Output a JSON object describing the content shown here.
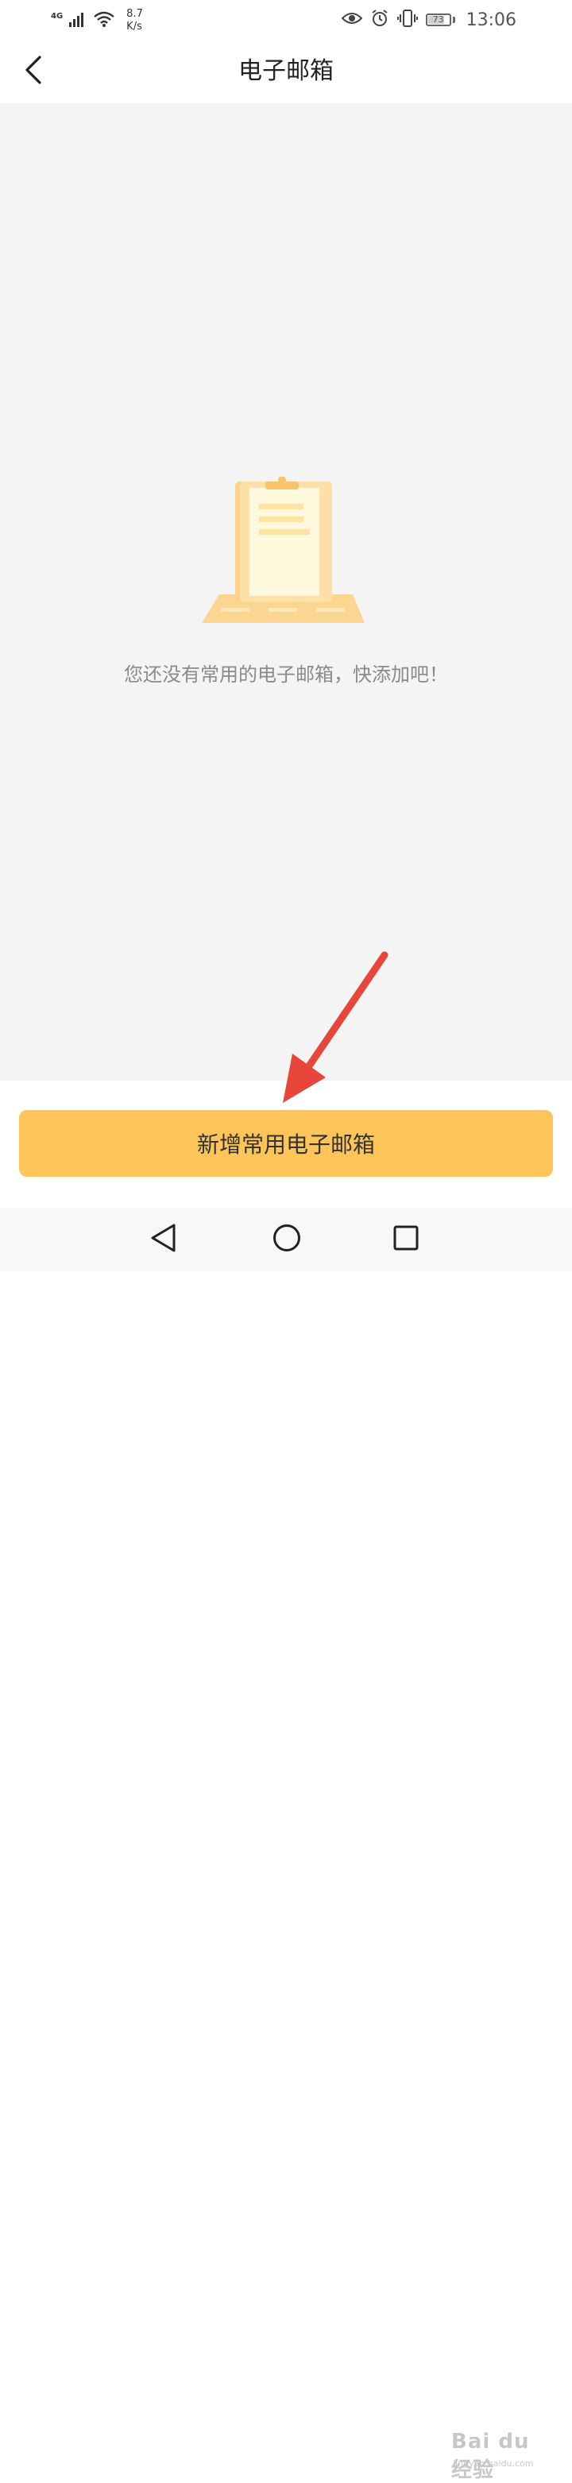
{
  "status_bar": {
    "network_type": "4G",
    "speed_value": "8.7",
    "speed_unit": "K/s",
    "battery_level": "73",
    "time": "13:06",
    "icons": [
      "signal-icon",
      "wifi-icon",
      "eye-icon",
      "alarm-icon",
      "vibrate-icon",
      "battery-icon"
    ]
  },
  "header": {
    "title": "电子邮箱",
    "back_icon": "chevron-left-icon"
  },
  "empty_state": {
    "illustration": "clipboard-illustration",
    "message": "您还没有常用的电子邮箱，快添加吧！"
  },
  "actions": {
    "add_label": "新增常用电子邮箱"
  },
  "annotation": {
    "arrow_color": "#e8463a"
  },
  "nav_bar": {
    "icons": [
      "nav-back-icon",
      "nav-home-icon",
      "nav-recent-icon"
    ]
  },
  "watermark": {
    "logo_text": "Bai du 经验",
    "url": "jingyan.baidu.com"
  },
  "colors": {
    "accent": "#fdc45a",
    "content_bg": "#f4f4f4",
    "empty_text": "#8a8a8a"
  }
}
